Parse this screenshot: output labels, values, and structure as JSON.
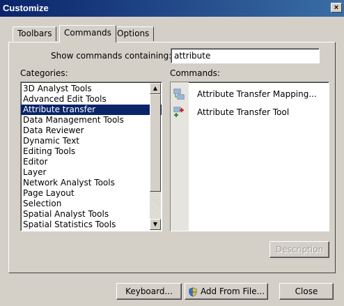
{
  "window": {
    "title": "Customize",
    "close_glyph": "×"
  },
  "tabs": [
    {
      "label": "Toolbars",
      "active": false
    },
    {
      "label": "Commands",
      "active": true
    },
    {
      "label": "Options",
      "active": false
    }
  ],
  "search": {
    "label": "Show commands containing:",
    "value": "attribute"
  },
  "categories": {
    "label": "Categories:",
    "selected": "Attribute transfer",
    "items": [
      "3D Analyst Tools",
      "Advanced Edit Tools",
      "Attribute transfer",
      "Data Management Tools",
      "Data Reviewer",
      "Dynamic Text",
      "Editing Tools",
      "Editor",
      "Layer",
      "Network Analyst Tools",
      "Page Layout",
      "Selection",
      "Spatial Analyst Tools",
      "Spatial Statistics Tools"
    ]
  },
  "commands": {
    "label": "Commands:",
    "items": [
      {
        "label": "Attribute Transfer Mapping...",
        "icon": "attribute-mapping-icon"
      },
      {
        "label": "Attribute Transfer Tool",
        "icon": "attribute-transfer-tool-icon"
      }
    ]
  },
  "description_button": "Description",
  "footer": {
    "keyboard": "Keyboard...",
    "add_from_file": "Add From File...",
    "close": "Close"
  },
  "colors": {
    "titlebar": "#0a246a",
    "selection": "#0a246a",
    "face": "#d4d0c8"
  }
}
